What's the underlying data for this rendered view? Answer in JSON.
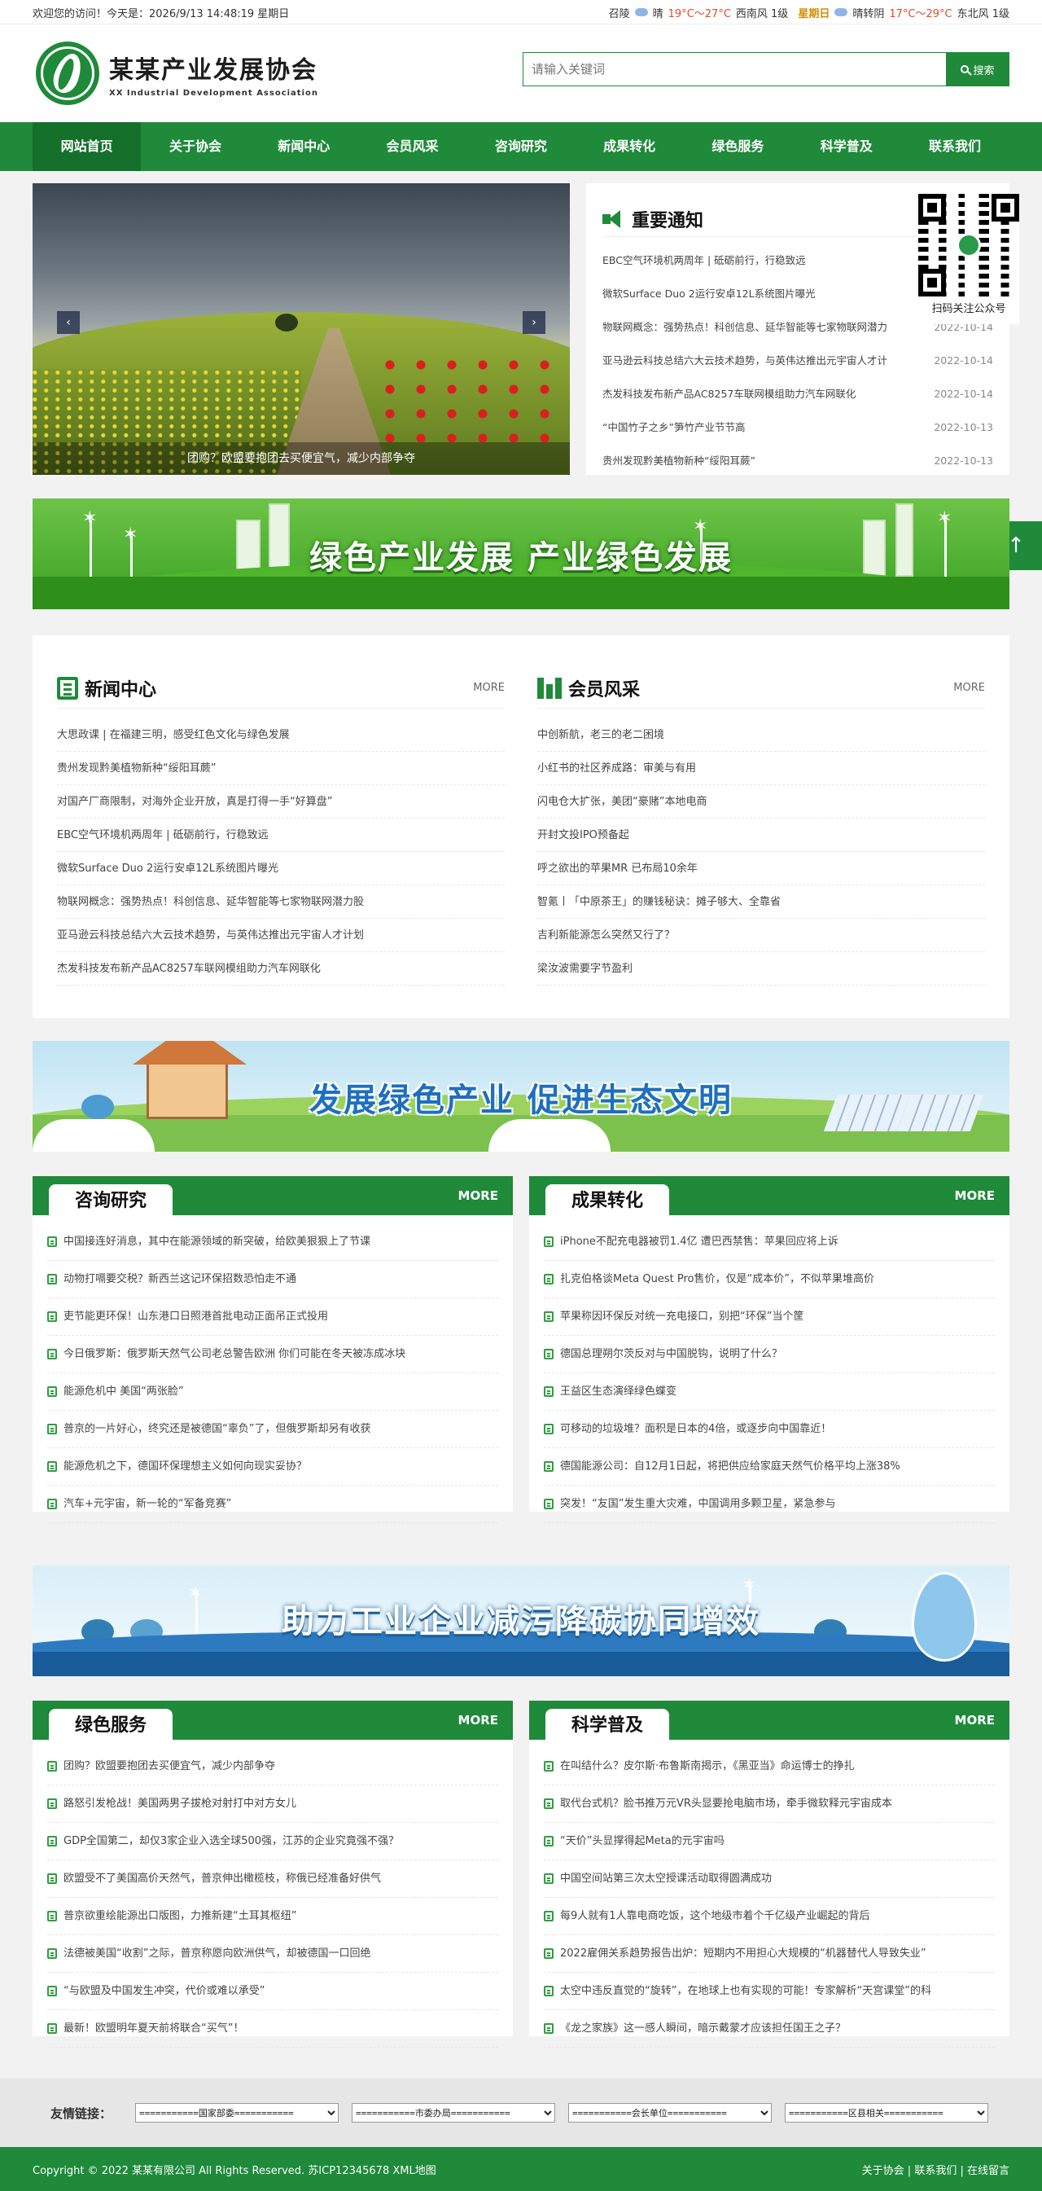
{
  "topbar": {
    "welcome": "欢迎您的访问！今天是：2026/9/13 14:48:19 星期日",
    "w1_place": "召陵",
    "w1_cond": "晴",
    "w1_temp": "19°C～27°C",
    "w1_wind": "西南风 1级",
    "w2_day": "星期日",
    "w2_cond": "晴转阴",
    "w2_temp": "17°C～29°C",
    "w2_wind": "东北风 1级"
  },
  "header": {
    "logo_cn": "某某产业发展协会",
    "logo_en": "XX Industrial Development Association",
    "search_placeholder": "请输入关键词",
    "search_button": "搜索"
  },
  "nav": [
    "网站首页",
    "关于协会",
    "新闻中心",
    "会员风采",
    "咨询研究",
    "成果转化",
    "绿色服务",
    "科学普及",
    "联系我们"
  ],
  "slider": {
    "caption": "团购？欧盟要抱团去买便宜气，减少内部争夺",
    "prev": "‹",
    "next": "›"
  },
  "notice": {
    "title": "重要通知",
    "items": [
      {
        "text": "EBC空气环境机两周年 | 砥砺前行，行稳致远",
        "date": ""
      },
      {
        "text": "微软Surface Duo 2运行安卓12L系统图片曝光",
        "date": ""
      },
      {
        "text": "物联网概念：强势热点！科创信息、延华智能等七家物联网潜力",
        "date": "2022-10-14"
      },
      {
        "text": "亚马逊云科技总结六大云技术趋势，与英伟达推出元宇宙人才计",
        "date": "2022-10-14"
      },
      {
        "text": "杰发科技发布新产品AC8257车联网模组助力汽车网联化",
        "date": "2022-10-14"
      },
      {
        "text": "“中国竹子之乡”笋竹产业节节高",
        "date": "2022-10-13"
      },
      {
        "text": "贵州发现黔美植物新种“绥阳耳蕨”",
        "date": "2022-10-13"
      }
    ]
  },
  "qr": {
    "caption": "扫码关注公众号"
  },
  "banners": {
    "b1": "绿色产业发展 产业绿色发展",
    "b2": "发展绿色产业 促进生态文明",
    "b3": "助力工业企业减污降碳协同增效"
  },
  "news": {
    "title": "新闻中心",
    "more": "MORE",
    "items": [
      "大思政课 | 在福建三明，感受红色文化与绿色发展",
      "贵州发现黔美植物新种“绥阳耳蕨”",
      "对国产厂商限制，对海外企业开放，真是打得一手“好算盘”",
      "EBC空气环境机两周年 | 砥砺前行，行稳致远",
      "微软Surface Duo 2运行安卓12L系统图片曝光",
      "物联网概念：强势热点！科创信息、延华智能等七家物联网潜力股",
      "亚马逊云科技总结六大云技术趋势，与英伟达推出元宇宙人才计划",
      "杰发科技发布新产品AC8257车联网模组助力汽车网联化"
    ]
  },
  "members": {
    "title": "会员风采",
    "more": "MORE",
    "items": [
      "中创新航，老三的老二困境",
      "小红书的社区养成路：审美与有用",
      "闪电仓大扩张，美团“豪赌”本地电商",
      "开封文投IPO预备起",
      "呼之欲出的苹果MR 已布局10余年",
      "智氪丨「中原茶王」的赚钱秘诀：摊子够大、全靠省",
      "吉利新能源怎么突然又行了？",
      "梁汝波需要字节盈利"
    ]
  },
  "consult": {
    "title": "咨询研究",
    "more": "MORE",
    "items": [
      "中国接连好消息，其中在能源领域的新突破，给欧美狠狠上了节课",
      "动物打嗝要交税？新西兰这记环保招数恐怕走不通",
      "吏节能更环保！山东港口日照港首批电动正面吊正式投用",
      "今日俄罗斯：俄罗斯天然气公司老总警告欧洲 你们可能在冬天被冻成冰块",
      "能源危机中 美国“两张脸”",
      "普京的一片好心，终究还是被德国“辜负”了，但俄罗斯却另有收获",
      "能源危机之下，德国环保理想主义如何向现实妥协？",
      "汽车+元宇宙，新一轮的“军备竞赛”"
    ]
  },
  "results": {
    "title": "成果转化",
    "more": "MORE",
    "items": [
      "iPhone不配充电器被罚1.4亿 遭巴西禁售：苹果回应将上诉",
      "扎克伯格谈Meta Quest Pro售价，仅是“成本价”，不似苹果堆高价",
      "苹果称因环保反对统一充电接口，别把“环保”当个筐",
      "德国总理朔尔茨反对与中国脱钩，说明了什么？",
      "王益区生态演绎绿色蝶变",
      "可移动的垃圾堆？面积是日本的4倍，或逐步向中国靠近！",
      "德国能源公司：自12月1日起，将把供应给家庭天然气价格平均上涨38%",
      "突发！“友国”发生重大灾难，中国调用多颗卫星，紧急参与"
    ]
  },
  "green": {
    "title": "绿色服务",
    "more": "MORE",
    "items": [
      "团购？欧盟要抱团去买便宜气，减少内部争夺",
      "路怒引发枪战！美国两男子拔枪对射打中对方女儿",
      "GDP全国第二，却仅3家企业入选全球500强，江苏的企业究竟强不强？",
      "欧盟受不了美国高价天然气，普京伸出橄榄枝，称俄已经准备好供气",
      "普京欲重绘能源出口版图，力推新建“土耳其枢纽”",
      "法德被美国“收割”之际，普京称愿向欧洲供气，却被德国一口回绝",
      "“与欧盟及中国发生冲突，代价或难以承受”",
      "最新！欧盟明年夏天前将联合“买气”！"
    ]
  },
  "science": {
    "title": "科学普及",
    "more": "MORE",
    "items": [
      "在叫结什么？皮尔斯·布鲁斯南揭示，《黑亚当》命运博士的挣扎",
      "取代台式机？脸书推万元VR头显要抢电脑市场，牵手微软释元宇宙成本",
      "“天价”头显撑得起Meta的元宇宙吗",
      "中国空间站第三次太空授课活动取得圆满成功",
      "每9人就有1人靠电商吃饭，这个地级市着个千亿级产业崛起的背后",
      "2022雇佣关系趋势报告出炉：短期内不用担心大规模的“机器替代人导致失业”",
      "太空中违反直觉的“旋转”，在地球上也有实现的可能！专家解析“天宫课堂”的科",
      "《龙之家族》这一感人瞬间，暗示戴蒙才应该担任国王之子？"
    ]
  },
  "friends": {
    "label": "友情链接：",
    "selects": [
      "===========国家部委===========",
      "===========市委办局===========",
      "===========会长单位===========",
      "===========区县相关==========="
    ]
  },
  "footer": {
    "copyright": "Copyright © 2022 某某有限公司 All Rights Reserved. 苏ICP12345678",
    "xml": "XML地图",
    "links": [
      "关于协会",
      "联系我们",
      "在线留言"
    ]
  },
  "back_top": "↑"
}
